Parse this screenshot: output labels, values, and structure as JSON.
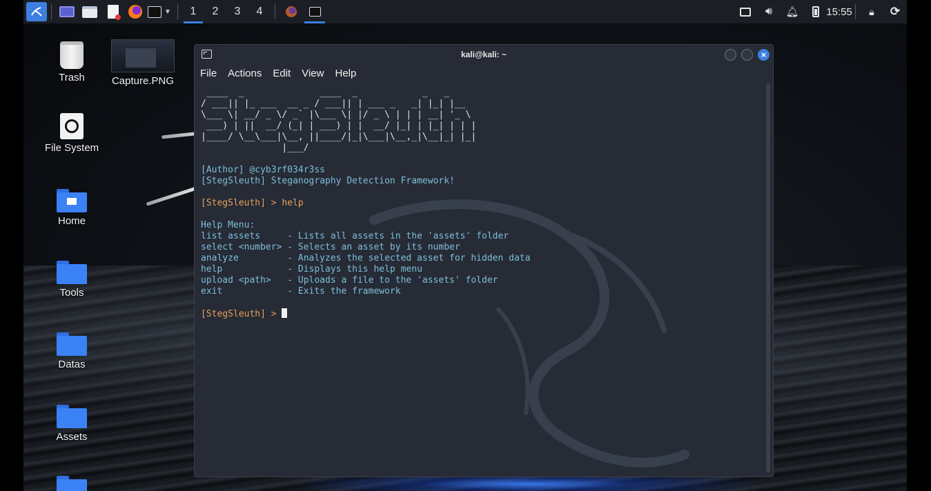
{
  "taskbar": {
    "workspaces": [
      "1",
      "2",
      "3",
      "4"
    ],
    "clock": "15:55",
    "accent": "#3d7fe0"
  },
  "desktop": {
    "icons": [
      {
        "label": "Trash",
        "icon": "trash-icon"
      },
      {
        "label": "Capture.PNG",
        "icon": "image-thumbnail-icon"
      },
      {
        "label": "File System",
        "icon": "drive-icon"
      },
      {
        "label": "Home",
        "icon": "home-folder-icon"
      },
      {
        "label": "Tools",
        "icon": "folder-icon"
      },
      {
        "label": "Datas",
        "icon": "folder-icon"
      },
      {
        "label": "Assets",
        "icon": "folder-icon"
      }
    ]
  },
  "terminal": {
    "title": "kali@kali: ~",
    "menu": [
      "File",
      "Actions",
      "Edit",
      "View",
      "Help"
    ],
    "banner": [
      " ____  _              ____  _            _   _     ",
      "/ ___|| |_ ___  __ _ / ___|| | ___ _   _| |_| |__  ",
      "\\___ \\| __/ _ \\/ _` |\\___ \\| |/ _ \\ | | | __| '_ \\ ",
      " ___) | ||  __/ (_| | ___) | |  __/ |_| | |_| | | |",
      "|____/ \\__\\___|\\__, ||____/|_|\\___|\\__,_|\\__|_| |_|",
      "               |___/                               "
    ],
    "author": "[Author] @cyb3rf034r3ss",
    "tagline": "[StegSleuth] Steganography Detection Framework!",
    "prompt": "[StegSleuth] > ",
    "command": "help",
    "help_header": "Help Menu:",
    "help_lines": [
      "list assets     - Lists all assets in the 'assets' folder",
      "select <number> - Selects an asset by its number",
      "analyze         - Analyzes the selected asset for hidden data",
      "help            - Displays this help menu",
      "upload <path>   - Uploads a file to the 'assets' folder",
      "exit            - Exits the framework"
    ],
    "prompt2": "[StegSleuth] > "
  }
}
